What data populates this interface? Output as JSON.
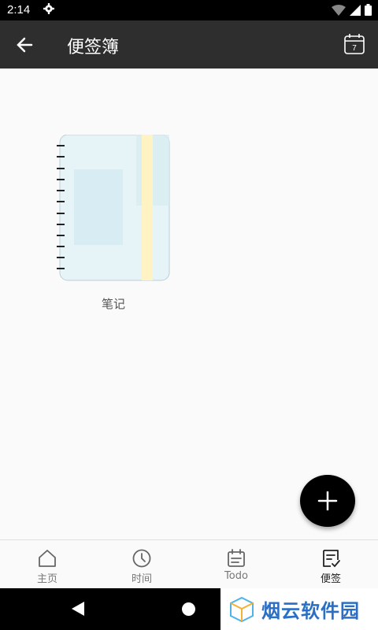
{
  "status_bar": {
    "time": "2:14"
  },
  "app_bar": {
    "title": "便签簿",
    "calendar_day": "7"
  },
  "notebooks": [
    {
      "label": "笔记"
    }
  ],
  "bottom_nav": [
    {
      "label": "主页",
      "icon": "home-icon"
    },
    {
      "label": "时间",
      "icon": "clock-icon"
    },
    {
      "label": "Todo",
      "icon": "todo-icon"
    },
    {
      "label": "便签",
      "icon": "note-icon",
      "active": true
    }
  ],
  "watermark": {
    "text": "烟云软件园"
  },
  "colors": {
    "app_bar": "#2e2e2e",
    "fab": "#000000",
    "notebook_cover": "#e6f4f8",
    "notebook_band": "#fff3c4"
  }
}
